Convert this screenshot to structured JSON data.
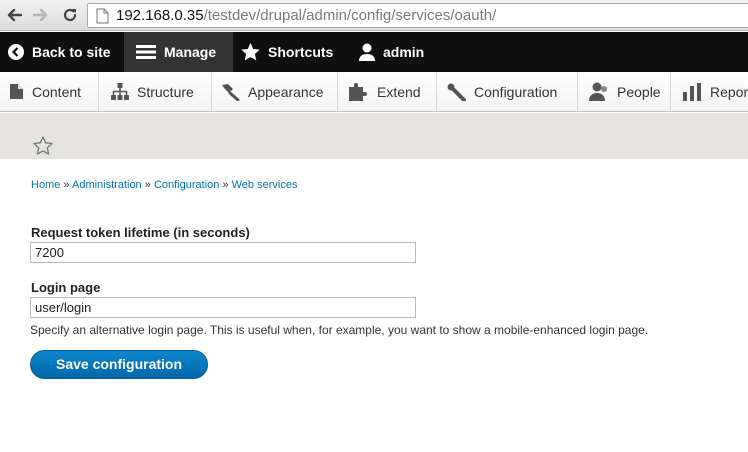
{
  "browser": {
    "url_host": "192.168.0.35",
    "url_path": "/testdev/drupal/admin/config/services/oauth/"
  },
  "toolbar": {
    "back_to_site": "Back to site",
    "manage": "Manage",
    "shortcuts": "Shortcuts",
    "user": "admin"
  },
  "tray": {
    "content": "Content",
    "structure": "Structure",
    "appearance": "Appearance",
    "extend": "Extend",
    "configuration": "Configuration",
    "people": "People",
    "reports": "Reports"
  },
  "breadcrumb": {
    "items": [
      "Home",
      "Administration",
      "Configuration",
      "Web services"
    ],
    "separator": "»"
  },
  "form": {
    "token_lifetime_label": "Request token lifetime (in seconds)",
    "token_lifetime_value": "7200",
    "login_page_label": "Login page",
    "login_page_value": "user/login",
    "login_page_description": "Specify an alternative login page. This is useful when, for example, you want to show a mobile-enhanced login page.",
    "save_label": "Save configuration"
  },
  "colors": {
    "toolbar_bg": "#0f0f0f",
    "link": "#0074bd",
    "primary_button": "#0074bd",
    "header_band": "#e4e4dc"
  }
}
